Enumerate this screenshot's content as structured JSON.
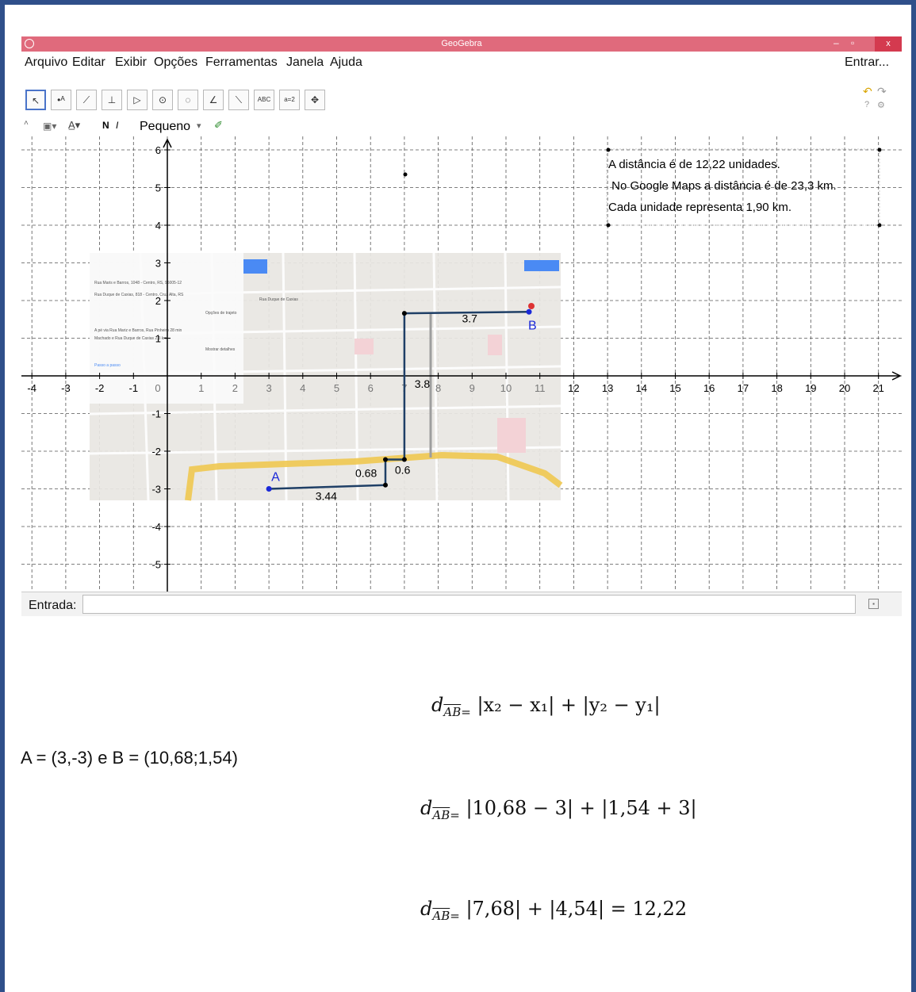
{
  "window": {
    "title": "GeoGebra",
    "minimize": "–",
    "restore": "▫",
    "close": "x"
  },
  "menu": {
    "items": [
      "Arquivo",
      "Editar",
      "Exibir",
      "Opções",
      "Ferramentas",
      "Janela",
      "Ajuda"
    ],
    "login": "Entrar..."
  },
  "toolbar": {
    "tools": [
      "move-tool",
      "point-tool",
      "line-tool",
      "perpendicular-tool",
      "polygon-tool",
      "circle-tool",
      "circle-3pt-tool",
      "angle-tool",
      "reflect-tool",
      "text-tool",
      "slider-tool",
      "move-view-tool"
    ],
    "text_tool_label": "ABC",
    "slider_tool_label": "a=2"
  },
  "stylebar": {
    "size_label": "Pequeno"
  },
  "graph": {
    "x_ticks": [
      "-4",
      "-3",
      "-2",
      "-1",
      "0",
      "1",
      "2",
      "3",
      "4",
      "5",
      "6",
      "7",
      "8",
      "9",
      "10",
      "11",
      "12",
      "13",
      "14",
      "15",
      "16",
      "17",
      "18",
      "19",
      "20",
      "21"
    ],
    "y_ticks": [
      "6",
      "5",
      "4",
      "3",
      "2",
      "1",
      "-1",
      "-2",
      "-3",
      "-4",
      "-5"
    ],
    "info_lines": [
      "A distância é de 12,22 unidades.",
      " No Google Maps a distância é de 23,3 km.",
      "Cada unidade representa 1,90 km."
    ],
    "point_a": "A",
    "point_b": "B",
    "segment_labels": [
      "3.7",
      "3.8",
      "0.6",
      "0.68",
      "3.44"
    ],
    "map_sidebar": [
      "Rua Maris e Barros, 1048 - Centro, RS, 96005-12",
      "Rua Duque de Caxias, 818 - Centro, Cruz Alta, RS",
      "Opções de trajeto",
      "A pé via Rua Mariz e Barros, Rua Pinheiro   28 min",
      "Machado e Rua Duque de Caxias  2,3 km",
      "Mostrar detalhes",
      "Passo a passo",
      "Rua Duque de Caxias"
    ],
    "map_colors": {
      "road": "#f0c850",
      "blue_button": "#4a8af4"
    }
  },
  "input_bar": {
    "label": "Entrada:",
    "value": ""
  },
  "document": {
    "formula_general": {
      "d": "d",
      "sub": "AB",
      "rest": "|x₂ − x₁| + |y₂ − y₁|"
    },
    "points_line": "A = (3,-3) e B = (10,68;1,54)",
    "formula_substituted": {
      "d": "d",
      "sub": "AB",
      "rest": "|10,68 − 3| + |1,54 + 3|"
    },
    "formula_result": {
      "d": "d",
      "sub": "AB",
      "rest": "|7,68| + |4,54| = 12,22"
    }
  },
  "colors": {
    "frame": "#2f4f8a",
    "titlebar": "#e06a7c",
    "point_label": "#1a28d8",
    "segment": "#1f3f66",
    "selected_tool": "#4a74c9"
  }
}
